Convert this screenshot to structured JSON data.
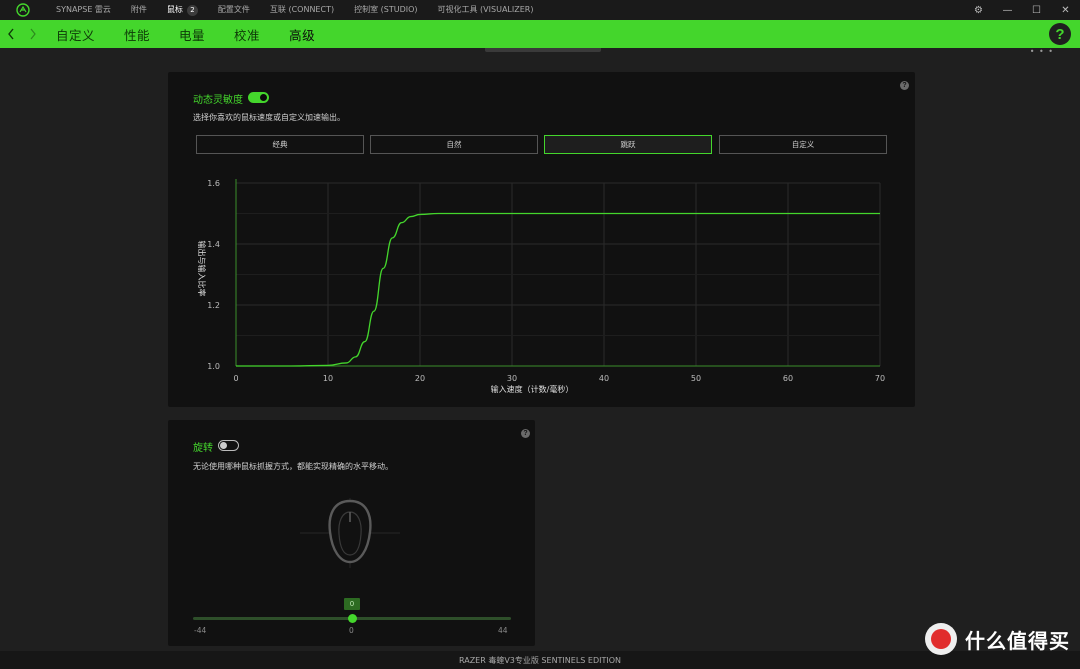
{
  "titlebar": {
    "nav": [
      {
        "label": "SYNAPSE 雷云",
        "active": false
      },
      {
        "label": "附件",
        "active": false
      },
      {
        "label": "鼠标",
        "active": true,
        "badge": "2"
      },
      {
        "label": "配置文件",
        "active": false
      },
      {
        "label": "互联 (CONNECT)",
        "active": false
      },
      {
        "label": "控制室 (STUDIO)",
        "active": false
      },
      {
        "label": "可视化工具 (VISUALIZER)",
        "active": false
      }
    ]
  },
  "subnav": {
    "tabs": [
      {
        "label": "自定义",
        "active": false
      },
      {
        "label": "性能",
        "active": false
      },
      {
        "label": "电量",
        "active": false
      },
      {
        "label": "校准",
        "active": false
      },
      {
        "label": "高级",
        "active": true
      }
    ],
    "help": "?"
  },
  "sensitivity": {
    "title": "动态灵敏度",
    "enabled": true,
    "description": "选择你喜欢的鼠标速度或自定义加速输出。",
    "curves": [
      {
        "label": "经典",
        "active": false
      },
      {
        "label": "自然",
        "active": false
      },
      {
        "label": "跳跃",
        "active": true
      },
      {
        "label": "自定义",
        "active": false
      }
    ]
  },
  "chart_data": {
    "type": "line",
    "xlabel": "输入速度（计数/毫秒）",
    "ylabel": "输出与输入比率",
    "xlim": [
      0,
      70
    ],
    "ylim": [
      1.0,
      1.6
    ],
    "xticks": [
      0,
      10,
      20,
      30,
      40,
      50,
      60,
      70
    ],
    "yticks": [
      1.0,
      1.2,
      1.4,
      1.6
    ],
    "grid": true,
    "series": [
      {
        "color": "#44d62c",
        "x": [
          0,
          6,
          10,
          12,
          13,
          14,
          15,
          16,
          17,
          18,
          19,
          20,
          22,
          25,
          30,
          40,
          50,
          60,
          70
        ],
        "y": [
          1.0,
          1.0,
          1.002,
          1.01,
          1.03,
          1.08,
          1.18,
          1.32,
          1.42,
          1.47,
          1.49,
          1.497,
          1.5,
          1.5,
          1.5,
          1.5,
          1.5,
          1.5,
          1.5
        ]
      }
    ]
  },
  "rotation": {
    "title": "旋转",
    "enabled": false,
    "description": "无论使用哪种鼠标抓握方式，都能实现精确的水平移动。",
    "slider": {
      "min": -44,
      "max": 44,
      "value": 0,
      "min_label": "-44",
      "max_label": "44",
      "value_label": "0",
      "center_label": "0"
    }
  },
  "footer": {
    "device": "RAZER 毒蝰V3专业版 SENTINELS EDITION"
  },
  "watermark": {
    "text": "什么值得买",
    "glyph": "值"
  },
  "colors": {
    "accent": "#44d62c",
    "panel": "#111111",
    "background": "#1f1f1f"
  }
}
